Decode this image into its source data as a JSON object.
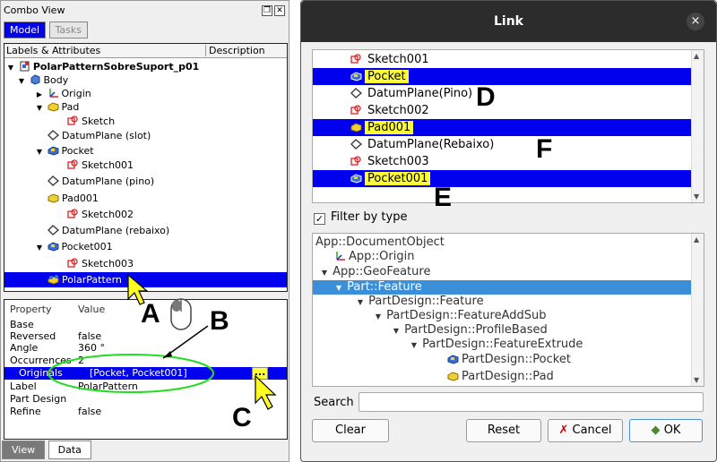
{
  "combo": {
    "title": "Combo View",
    "tabs": [
      "Model",
      "Tasks"
    ],
    "tree_headers": [
      "Labels & Attributes",
      "Description"
    ],
    "tree": [
      {
        "label": "PolarPatternSobreSuport_p01",
        "icon": "document-icon"
      },
      {
        "label": "Body",
        "icon": "body-icon"
      },
      {
        "label": "Origin",
        "icon": "origin-icon"
      },
      {
        "label": "Pad",
        "icon": "pad-icon"
      },
      {
        "label": "Sketch",
        "icon": "sketch-icon"
      },
      {
        "label": "DatumPlane (slot)",
        "icon": "datum-plane-icon"
      },
      {
        "label": "Pocket",
        "icon": "pocket-icon"
      },
      {
        "label": "Sketch001",
        "icon": "sketch-icon"
      },
      {
        "label": "DatumPlane (pino)",
        "icon": "datum-plane-icon"
      },
      {
        "label": "Pad001",
        "icon": "pad-icon"
      },
      {
        "label": "Sketch002",
        "icon": "sketch-icon"
      },
      {
        "label": "DatumPlane (rebaixo)",
        "icon": "datum-plane-icon"
      },
      {
        "label": "Pocket001",
        "icon": "pocket-icon"
      },
      {
        "label": "Sketch003",
        "icon": "sketch-icon"
      },
      {
        "label": "PolarPattern",
        "icon": "polar-pattern-icon"
      }
    ],
    "prop_headers": [
      "Property",
      "Value"
    ],
    "properties": [
      {
        "name": "Base",
        "value": ""
      },
      {
        "name": "Reversed",
        "value": "false"
      },
      {
        "name": "Angle",
        "value": "360 °"
      },
      {
        "name": "Occurrences",
        "value": "2"
      },
      {
        "name": "Originals",
        "value": "[Pocket, Pocket001]"
      },
      {
        "name": "Label",
        "value": "PolarPattern"
      },
      {
        "name": "Part Design",
        "value": ""
      },
      {
        "name": "Refine",
        "value": "false"
      }
    ],
    "ellipsis": "...",
    "bottom_tabs": [
      "View",
      "Data"
    ]
  },
  "dialog": {
    "title": "Link",
    "close": "×",
    "objects": [
      {
        "label": "Sketch001",
        "icon": "sketch-icon"
      },
      {
        "label": "Pocket",
        "icon": "pocket-icon"
      },
      {
        "label": "DatumPlane(Pino)",
        "icon": "datum-plane-icon"
      },
      {
        "label": "Sketch002",
        "icon": "sketch-icon"
      },
      {
        "label": "Pad001",
        "icon": "pad-icon"
      },
      {
        "label": "DatumPlane(Rebaixo)",
        "icon": "datum-plane-icon"
      },
      {
        "label": "Sketch003",
        "icon": "sketch-icon"
      },
      {
        "label": "Pocket001",
        "icon": "pocket-icon"
      }
    ],
    "filter_label": "Filter by type",
    "filter_check": "✓",
    "types": [
      {
        "label": "App::DocumentObject",
        "arrow": ""
      },
      {
        "label": "App::Origin",
        "arrow": ""
      },
      {
        "label": "App::GeoFeature",
        "arrow": "▼"
      },
      {
        "label": "Part::Feature",
        "arrow": "▼"
      },
      {
        "label": "PartDesign::Feature",
        "arrow": "▼"
      },
      {
        "label": "PartDesign::FeatureAddSub",
        "arrow": "▼"
      },
      {
        "label": "PartDesign::ProfileBased",
        "arrow": "▼"
      },
      {
        "label": "PartDesign::FeatureExtrude",
        "arrow": "▼"
      },
      {
        "label": "PartDesign::Pocket",
        "arrow": ""
      },
      {
        "label": "PartDesign::Pad",
        "arrow": ""
      }
    ],
    "search_label": "Search",
    "search_value": "",
    "buttons": {
      "clear": "Clear",
      "reset": "Reset",
      "cancel": "Cancel",
      "ok": "OK"
    }
  },
  "annotations": {
    "a": "A",
    "b": "B",
    "c": "C",
    "d": "D",
    "e": "E",
    "f": "F"
  }
}
